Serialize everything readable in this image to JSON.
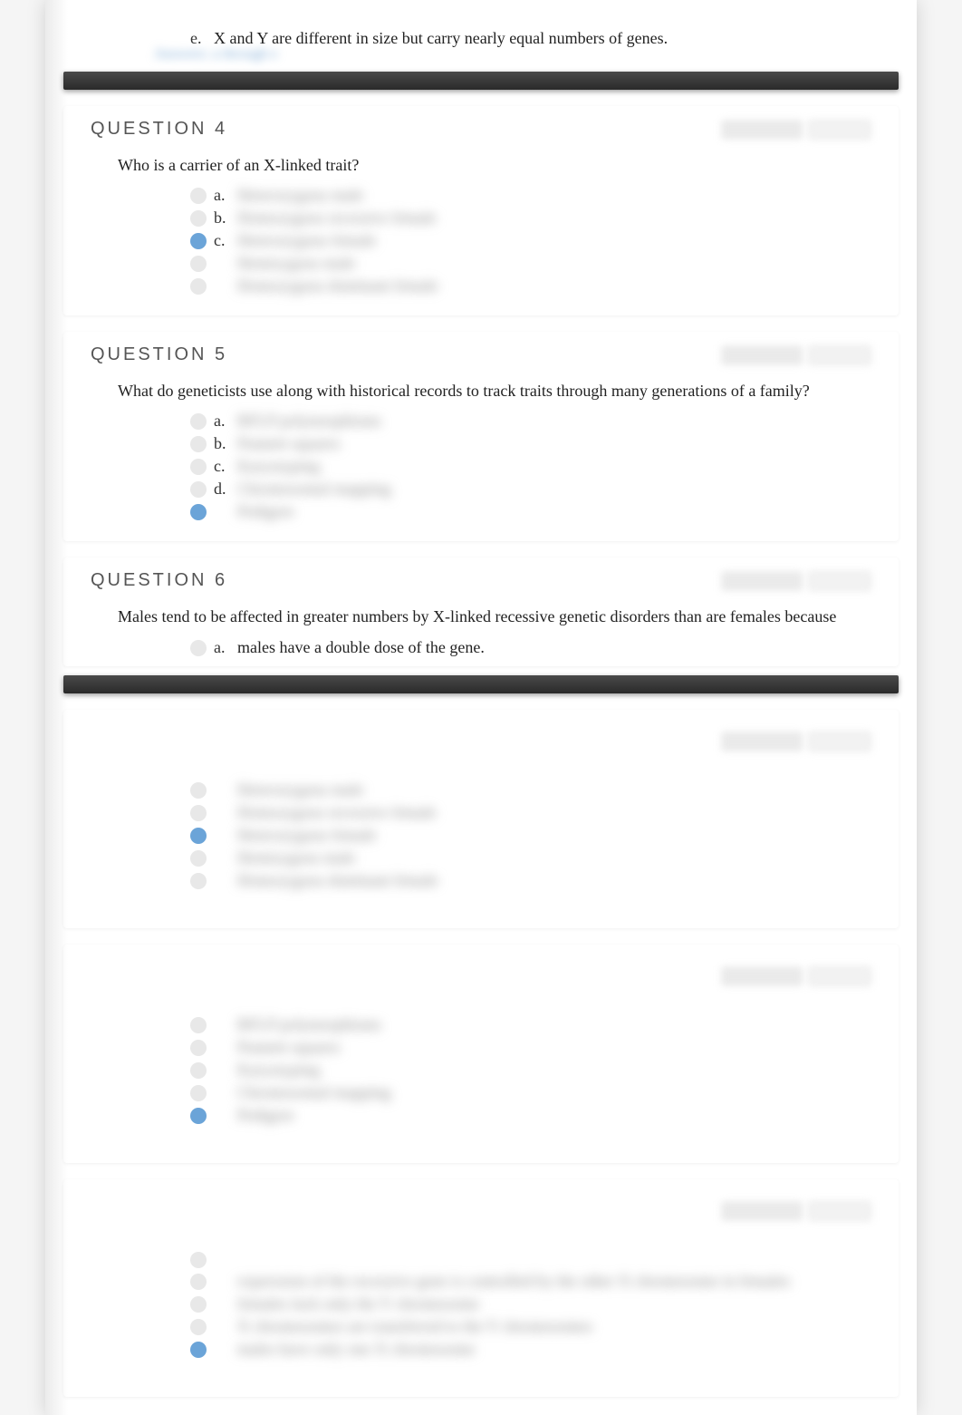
{
  "top_option": {
    "letter": "e.",
    "text": "X and Y are different in size but carry nearly equal numbers of genes."
  },
  "blurred_link": "Answers: a through e",
  "q4": {
    "title": "QUESTION 4",
    "prompt": "Who is a carrier of an X-linked trait?",
    "options": [
      {
        "letter": "a.",
        "text": "Heterozygous male",
        "selected": false
      },
      {
        "letter": "b.",
        "text": "Homozygous recessive female",
        "selected": false
      },
      {
        "letter": "c.",
        "text": "Heterozygous female",
        "selected": true
      },
      {
        "letter": "",
        "text": "Hemizygous male",
        "selected": false
      },
      {
        "letter": "",
        "text": "Homozygous dominant female",
        "selected": false
      }
    ]
  },
  "q5": {
    "title": "QUESTION 5",
    "prompt": "What do geneticists use along with historical records to track traits through many generations of a family?",
    "options": [
      {
        "letter": "a.",
        "text": "RFLP polymorphisms",
        "selected": false
      },
      {
        "letter": "b.",
        "text": "Punnett squares",
        "selected": false
      },
      {
        "letter": "c.",
        "text": "Karyotyping",
        "selected": false
      },
      {
        "letter": "d.",
        "text": "Chromosomal mapping",
        "selected": false
      },
      {
        "letter": "",
        "text": "Pedigree",
        "selected": true
      }
    ]
  },
  "q6": {
    "title": "QUESTION 6",
    "prompt": "Males tend to be affected in greater numbers by X-linked recessive genetic disorders than are females because",
    "options": [
      {
        "letter": "a.",
        "text": "males have a double dose of the gene.",
        "selected": false
      }
    ]
  },
  "block7": {
    "options": [
      {
        "text": "Heterozygous male",
        "selected": false
      },
      {
        "text": "Homozygous recessive female",
        "selected": false
      },
      {
        "text": "Heterozygous female",
        "selected": true
      },
      {
        "text": "Hemizygous male",
        "selected": false
      },
      {
        "text": "Homozygous dominant female",
        "selected": false
      }
    ]
  },
  "block8": {
    "options": [
      {
        "text": "RFLP polymorphisms",
        "selected": false
      },
      {
        "text": "Punnett squares",
        "selected": false
      },
      {
        "text": "Karyotyping",
        "selected": false
      },
      {
        "text": "Chromosomal mapping",
        "selected": false
      },
      {
        "text": "Pedigree",
        "selected": true
      }
    ]
  },
  "block9": {
    "points_label": "0.8 points",
    "save_label": "Saved",
    "options": [
      {
        "text": "",
        "selected": false
      },
      {
        "text": "expression of the recessive gene is controlled by the other X chromosome in females",
        "selected": false
      },
      {
        "text": "females lack only the Y chromosome",
        "selected": false
      },
      {
        "text": "X chromosomes are transferred to the Y chromosomes",
        "selected": false
      },
      {
        "text": "males have only one X chromosome",
        "selected": true
      }
    ]
  }
}
